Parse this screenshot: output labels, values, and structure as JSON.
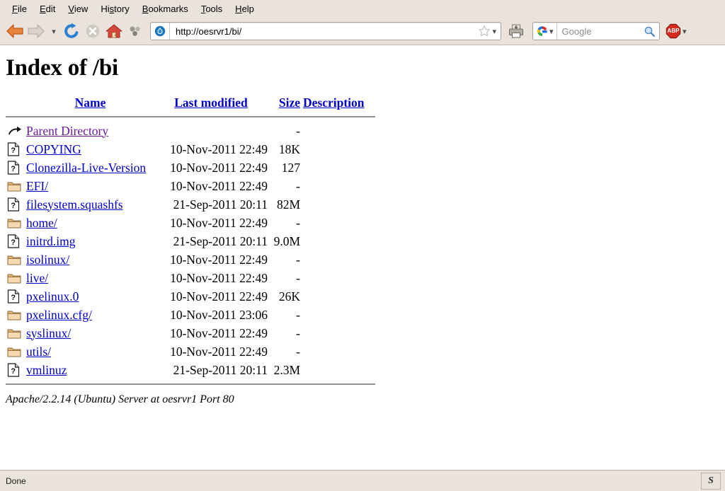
{
  "browser": {
    "menubar": [
      {
        "label": "File",
        "accesskey": "F"
      },
      {
        "label": "Edit",
        "accesskey": "E"
      },
      {
        "label": "View",
        "accesskey": "V"
      },
      {
        "label": "History",
        "accesskey": "s"
      },
      {
        "label": "Bookmarks",
        "accesskey": "B"
      },
      {
        "label": "Tools",
        "accesskey": "T"
      },
      {
        "label": "Help",
        "accesskey": "H"
      }
    ],
    "toolbar": {
      "back_icon": "back-arrow-icon",
      "forward_icon": "forward-arrow-icon",
      "history_dropdown_icon": "chevron-down-icon",
      "reload_icon": "reload-icon",
      "stop_icon": "stop-icon",
      "home_icon": "home-icon",
      "extension_icon": "molecule-icon",
      "print_icon": "printer-icon"
    },
    "urlbar": {
      "favicon": "drupal-droplet-icon",
      "url": "http://oesrvr1/bi/",
      "bookmark_icon": "star-icon",
      "bookmark_dropdown_icon": "chevron-down-icon"
    },
    "search": {
      "engine_icon": "google-icon",
      "engine_dropdown_icon": "chevron-down-icon",
      "placeholder": "Google",
      "go_icon": "magnifier-icon"
    },
    "adblock": {
      "label": "ABP",
      "color": "#d62d20",
      "dropdown_icon": "chevron-down-icon"
    }
  },
  "page": {
    "title": "Index of /bi",
    "columns": {
      "icon": "",
      "name": "Name",
      "last_modified": "Last modified",
      "size": "Size",
      "description": "Description"
    },
    "rows": [
      {
        "icon": "parent-directory-icon",
        "name": "Parent Directory",
        "date": "",
        "size": "-",
        "desc": "",
        "visited": true
      },
      {
        "icon": "unknown-file-icon",
        "name": "COPYING",
        "date": "10-Nov-2011 22:49",
        "size": "18K",
        "desc": "",
        "visited": false
      },
      {
        "icon": "unknown-file-icon",
        "name": "Clonezilla-Live-Version",
        "date": "10-Nov-2011 22:49",
        "size": "127",
        "desc": "",
        "visited": false
      },
      {
        "icon": "folder-icon",
        "name": "EFI/",
        "date": "10-Nov-2011 22:49",
        "size": "-",
        "desc": "",
        "visited": false
      },
      {
        "icon": "unknown-file-icon",
        "name": "filesystem.squashfs",
        "date": "21-Sep-2011 20:11",
        "size": "82M",
        "desc": "",
        "visited": false
      },
      {
        "icon": "folder-icon",
        "name": "home/",
        "date": "10-Nov-2011 22:49",
        "size": "-",
        "desc": "",
        "visited": false
      },
      {
        "icon": "unknown-file-icon",
        "name": "initrd.img",
        "date": "21-Sep-2011 20:11",
        "size": "9.0M",
        "desc": "",
        "visited": false
      },
      {
        "icon": "folder-icon",
        "name": "isolinux/",
        "date": "10-Nov-2011 22:49",
        "size": "-",
        "desc": "",
        "visited": false
      },
      {
        "icon": "folder-icon",
        "name": "live/",
        "date": "10-Nov-2011 22:49",
        "size": "-",
        "desc": "",
        "visited": false
      },
      {
        "icon": "unknown-file-icon",
        "name": "pxelinux.0",
        "date": "10-Nov-2011 22:49",
        "size": "26K",
        "desc": "",
        "visited": false
      },
      {
        "icon": "folder-icon",
        "name": "pxelinux.cfg/",
        "date": "10-Nov-2011 23:06",
        "size": "-",
        "desc": "",
        "visited": false
      },
      {
        "icon": "folder-icon",
        "name": "syslinux/",
        "date": "10-Nov-2011 22:49",
        "size": "-",
        "desc": "",
        "visited": false
      },
      {
        "icon": "folder-icon",
        "name": "utils/",
        "date": "10-Nov-2011 22:49",
        "size": "-",
        "desc": "",
        "visited": false
      },
      {
        "icon": "unknown-file-icon",
        "name": "vmlinuz",
        "date": "21-Sep-2011 20:11",
        "size": "2.3M",
        "desc": "",
        "visited": false
      }
    ],
    "footer": "Apache/2.2.14 (Ubuntu) Server at oesrvr1 Port 80"
  },
  "statusbar": {
    "text": "Done",
    "indicator": "S"
  },
  "colors": {
    "link": "#0000cc",
    "visited_link": "#6a1b9a",
    "chrome_bg": "#e9e3db",
    "accent_back": "#e8833a"
  }
}
